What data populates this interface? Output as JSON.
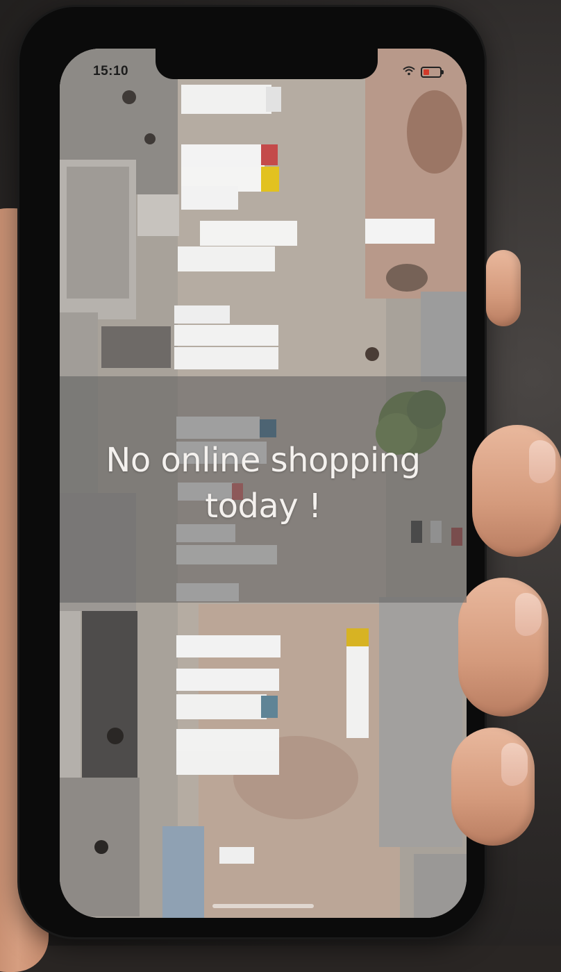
{
  "status_bar": {
    "time": "15:10",
    "wifi_icon": "wifi-icon",
    "battery_icon": "battery-low-icon",
    "battery_color": "#d23a2a"
  },
  "screen": {
    "background": "aerial-warehouse-truck-yard-photo",
    "message_line1": "No online shopping",
    "message_line2": "today !",
    "banner_color": "#5c5c5c"
  }
}
